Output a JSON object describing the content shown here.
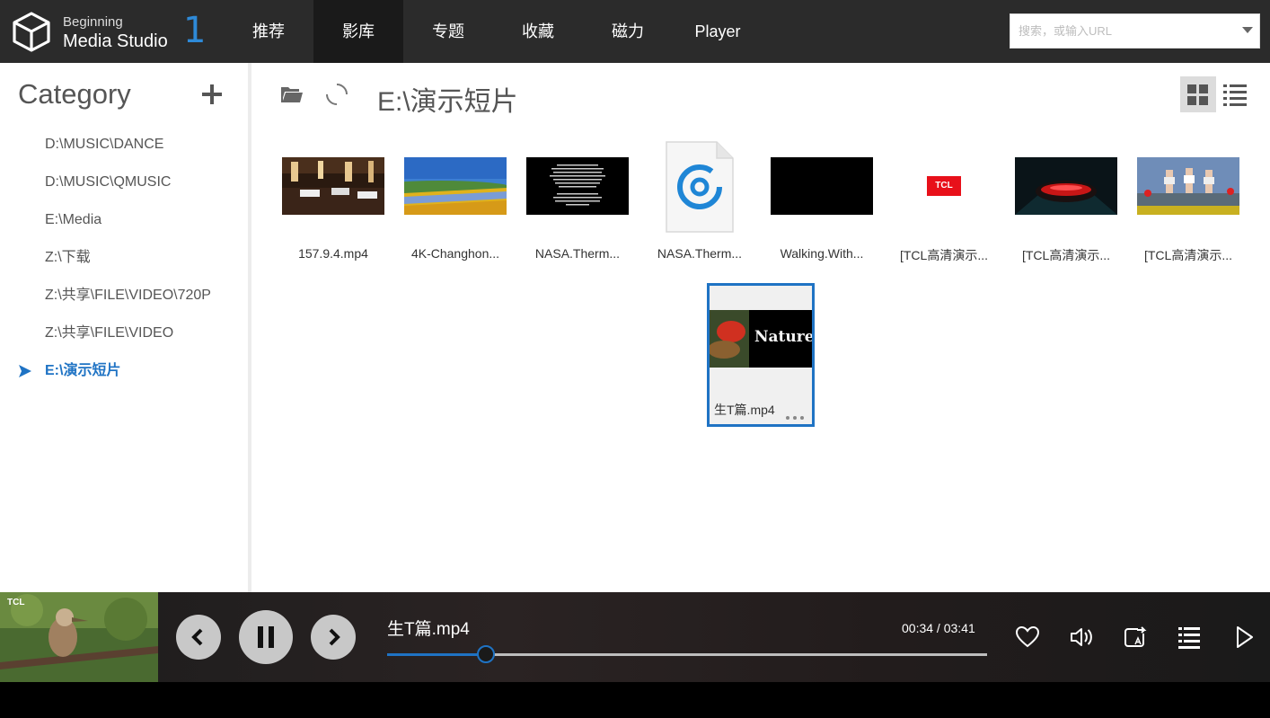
{
  "app": {
    "brand_line1": "Beginning",
    "brand_line2": "Media Studio",
    "brand_number": "1"
  },
  "nav": {
    "items": [
      {
        "label": "推荐",
        "active": false
      },
      {
        "label": "影库",
        "active": true
      },
      {
        "label": "专题",
        "active": false
      },
      {
        "label": "收藏",
        "active": false
      },
      {
        "label": "磁力",
        "active": false
      },
      {
        "label": "Player",
        "active": false
      }
    ]
  },
  "search": {
    "placeholder": "搜索，或输入URL",
    "value": ""
  },
  "sidebar": {
    "title": "Category",
    "items": [
      {
        "label": "D:\\MUSIC\\DANCE",
        "active": false
      },
      {
        "label": "D:\\MUSIC\\QMUSIC",
        "active": false
      },
      {
        "label": "E:\\Media",
        "active": false
      },
      {
        "label": "Z:\\下载",
        "active": false
      },
      {
        "label": "Z:\\共享\\FILE\\VIDEO\\720P",
        "active": false
      },
      {
        "label": "Z:\\共享\\FILE\\VIDEO",
        "active": false
      },
      {
        "label": "E:\\演示短片",
        "active": true
      }
    ]
  },
  "main": {
    "path": "E:\\演示短片",
    "view_mode": "grid",
    "files": [
      {
        "label": "157.9.4.mp4",
        "thumb": "restaurant"
      },
      {
        "label": "4K-Changhon...",
        "thumb": "landscape"
      },
      {
        "label": "NASA.Therm...",
        "thumb": "text-black"
      },
      {
        "label": "NASA.Therm...",
        "thumb": "file-icon"
      },
      {
        "label": "Walking.With...",
        "thumb": "black"
      },
      {
        "label": "[TCL高清演示...",
        "thumb": "tcl-logo"
      },
      {
        "label": "[TCL高清演示...",
        "thumb": "car"
      },
      {
        "label": "[TCL高清演示...",
        "thumb": "models"
      }
    ],
    "selected_file": {
      "label": "生T篇.mp4",
      "thumb": "nature",
      "thumb_text": "Nature"
    },
    "thumb_texts": {
      "tcl": "TCL"
    }
  },
  "player": {
    "title": "生T篇.mp4",
    "time": "00:34 / 03:41",
    "progress": 0.165,
    "art_badge": "TCL"
  },
  "colors": {
    "accent": "#1f73c4",
    "topbar": "#2b2b2b",
    "nav_active": "#1a1a1a"
  }
}
